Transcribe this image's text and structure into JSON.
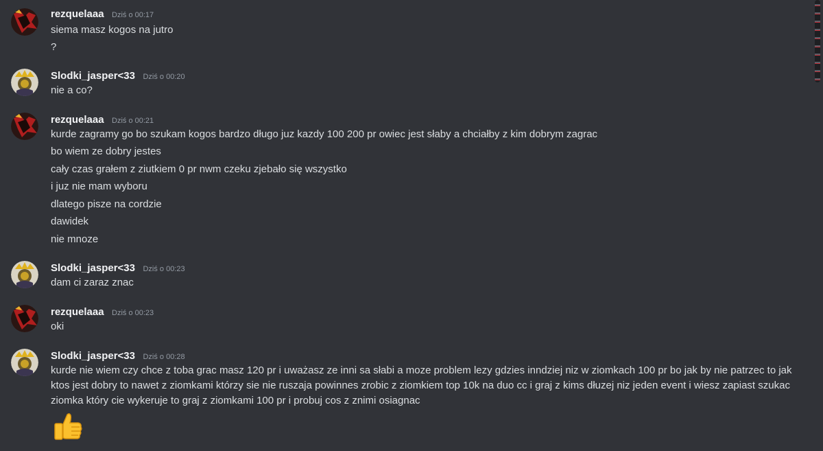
{
  "messages": [
    {
      "author": "rezquelaaa",
      "timestamp": "Dziś o 00:17",
      "lines": [
        "siema masz kogos na jutro",
        "?"
      ]
    },
    {
      "author": "Slodki_jasper<33",
      "timestamp": "Dziś o 00:20",
      "lines": [
        "nie a co?"
      ]
    },
    {
      "author": "rezquelaaa",
      "timestamp": "Dziś o 00:21",
      "lines": [
        "kurde zagramy go bo szukam kogos bardzo długo juz kazdy 100 200 pr owiec jest słaby a chciałby z kim dobrym zagrac",
        "bo wiem ze dobry jestes",
        "cały czas grałem z ziutkiem 0 pr nwm czeku zjebało się wszystko",
        "i juz nie mam wyboru",
        "dlatego pisze na cordzie",
        "dawidek",
        "nie mnoze"
      ]
    },
    {
      "author": "Slodki_jasper<33",
      "timestamp": "Dziś o 00:23",
      "lines": [
        "dam ci zaraz znac"
      ]
    },
    {
      "author": "rezquelaaa",
      "timestamp": "Dziś o 00:23",
      "lines": [
        "oki"
      ]
    },
    {
      "author": "Slodki_jasper<33",
      "timestamp": "Dziś o 00:28",
      "lines": [
        "kurde nie wiem czy chce z toba grac masz 120 pr i uważasz ze inni sa słabi a moze problem lezy gdzies inndziej niz w ziomkach 100 pr bo jak by nie patrzec to jak ktos jest dobry to nawet z ziomkami którzy sie nie ruszaja powinnes zrobic z ziomkiem top 10k na duo cc i graj z kims dłuzej niz jeden event i wiesz zapiast szukac ziomka który cie wykeruje to graj z ziomkami 100 pr i probuj cos z znimi osiagnac"
      ],
      "emoji": "thumbs-up"
    }
  ],
  "colors": {
    "background": "#313338",
    "username": "#f2f3f5",
    "text": "#dbdee1",
    "timestamp": "#949ba4"
  },
  "icons": {
    "avatar_rezquelaaa": "dark-red-abstract-avatar",
    "avatar_slodki": "gold-crowned-character-avatar",
    "reaction_emoji": "thumbs-up-emoji"
  }
}
